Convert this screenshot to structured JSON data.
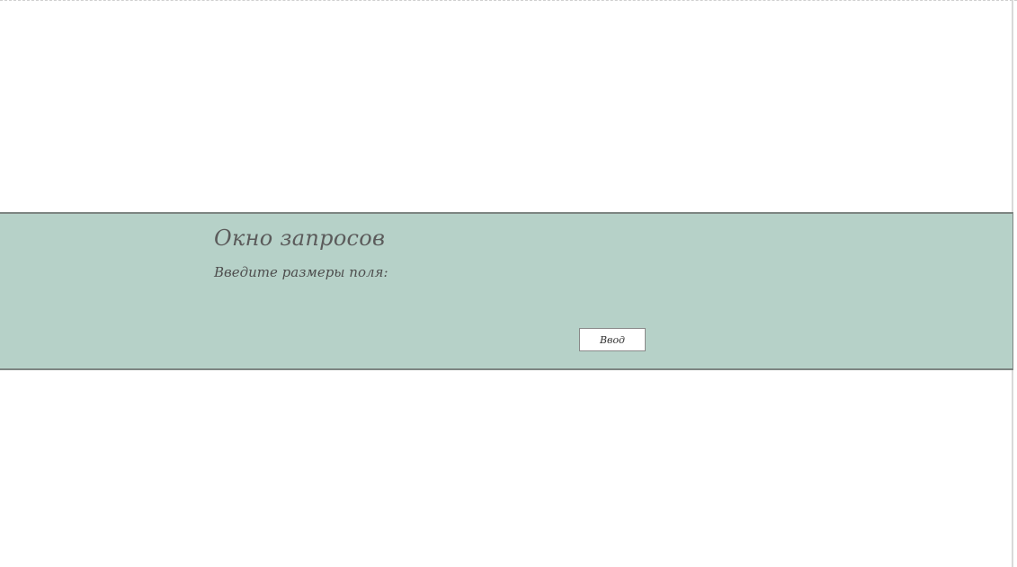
{
  "dialog": {
    "title": "Окно запросов",
    "prompt": "Введите размеры поля:",
    "submit_label": "Ввод"
  },
  "colors": {
    "band_background": "#b6d1c8",
    "band_border": "#7d8582",
    "text": "#5b5b5b",
    "button_background": "#ffffff"
  }
}
